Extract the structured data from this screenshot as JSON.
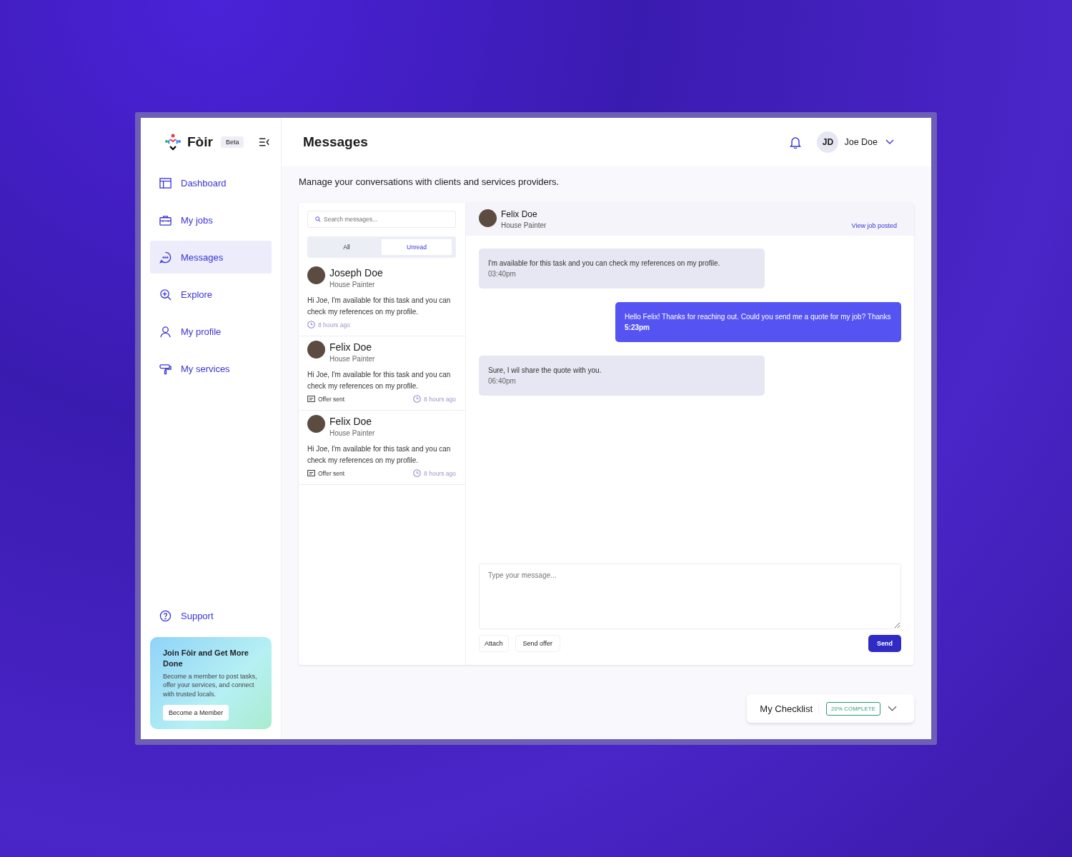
{
  "brand": {
    "name": "Fòir",
    "badge": "Beta"
  },
  "page_title": "Messages",
  "user": {
    "initials": "JD",
    "name": "Joe Doe"
  },
  "sidebar": {
    "items": [
      {
        "label": "Dashboard",
        "selected": false
      },
      {
        "label": "My jobs",
        "selected": false
      },
      {
        "label": "Messages",
        "selected": true
      },
      {
        "label": "Explore",
        "selected": false
      },
      {
        "label": "My profile",
        "selected": false
      },
      {
        "label": "My services",
        "selected": false
      }
    ],
    "support": "Support"
  },
  "promo": {
    "title": "Join Fòir and Get More Done",
    "text": "Become a member to post tasks, offer your services, and connect with trusted locals.",
    "button": "Become a Member"
  },
  "subtitle": "Manage your conversations with clients and services providers.",
  "search": {
    "placeholder": "Search messages..."
  },
  "filter_tabs": [
    {
      "label": "All",
      "selected": false
    },
    {
      "label": "Unread",
      "selected": true
    }
  ],
  "conversations": [
    {
      "name": "Joseph Doe",
      "role": "House Painter",
      "preview": "Hi Joe, I'm available for this task and you can check my references on my profile.",
      "time": "8 hours ago"
    },
    {
      "name": "Felix Doe",
      "role": "House Painter",
      "preview": "Hi Joe, I'm available for this task and you can check my references on my profile.",
      "offer": "Offer sent",
      "time": "8 hours ago"
    },
    {
      "name": "Felix Doe",
      "role": "House Painter",
      "preview": "Hi Joe, I'm available for this task and you can check my references on my profile.",
      "offer": "Offer sent",
      "time": "8 hours ago"
    }
  ],
  "chat": {
    "contact": {
      "name": "Felix Doe",
      "role": "House Painter"
    },
    "link": "View job posted",
    "messages": [
      {
        "text": "I'm available for this task and you can check my references on my profile.",
        "time": "03:40pm",
        "outgoing": false
      },
      {
        "text": "Hello Felix! Thanks for reaching out. Could you send me a quote for my job? Thanks",
        "time": "5:23pm",
        "outgoing": true
      },
      {
        "text": "Sure, I wil share the quote with you.",
        "time": "06:40pm",
        "outgoing": false
      }
    ]
  },
  "composer": {
    "placeholder": "Type your message...",
    "buttons": [
      "Attach",
      "Send offer"
    ],
    "send": "Send"
  },
  "checklist": {
    "title": "My Checklist",
    "badge": "20% COMPLETE"
  }
}
